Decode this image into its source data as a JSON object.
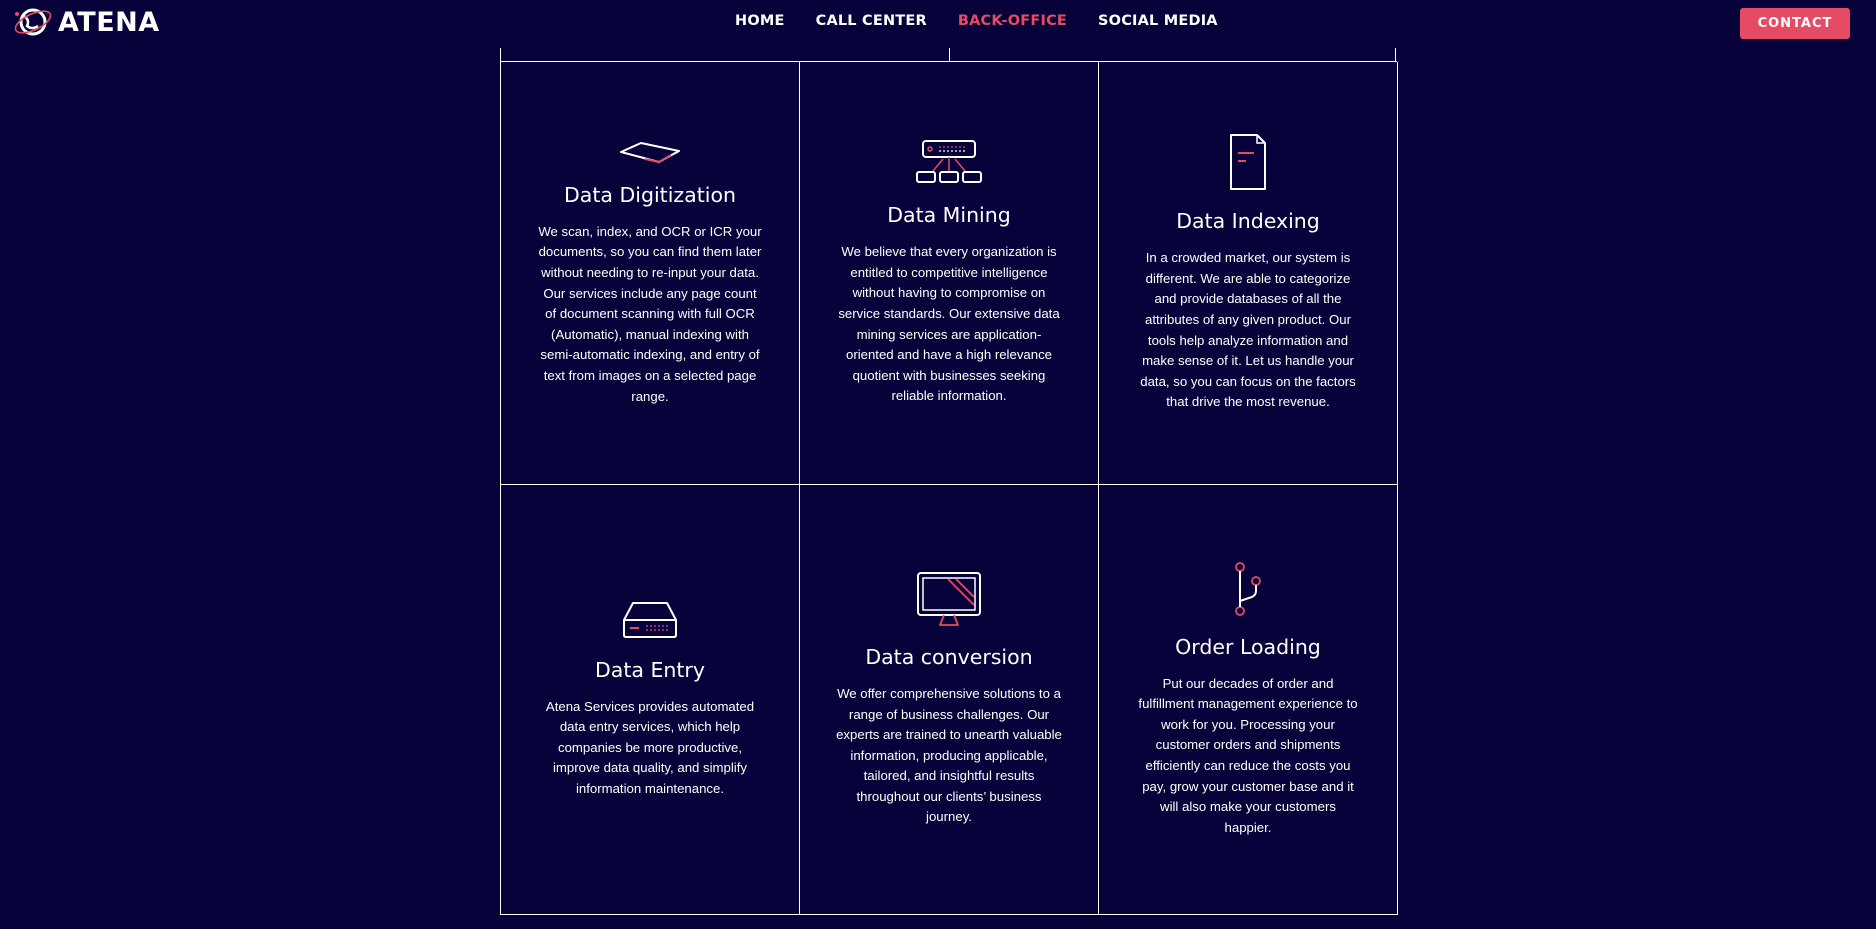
{
  "header": {
    "logo_text": "ATENA",
    "nav": [
      {
        "label": "HOME",
        "active": false
      },
      {
        "label": "CALL CENTER",
        "active": false
      },
      {
        "label": "BACK-OFFICE",
        "active": true
      },
      {
        "label": "SOCIAL MEDIA",
        "active": false
      }
    ],
    "contact_label": "CONTACT"
  },
  "colors": {
    "background": "#07033a",
    "accent": "#e54b64",
    "text": "#ffffff"
  },
  "services": [
    {
      "icon": "scanner-icon",
      "title": "Data Digitization",
      "description": "We scan, index, and OCR or ICR your documents, so you can find them later without needing to re-input your data. Our services include any page count of document scanning with full OCR (Automatic), manual indexing with semi-automatic indexing, and entry of text from images on a selected page range."
    },
    {
      "icon": "network-icon",
      "title": "Data Mining",
      "description": "We believe that every organization is entitled to competitive intelligence without having to compromise on service standards. Our extensive data mining services are application-oriented and have a high relevance quotient with businesses seeking reliable information."
    },
    {
      "icon": "document-icon",
      "title": "Data Indexing",
      "description": "In a crowded market, our system is different. We are able to categorize and provide databases of all the attributes of any given product. Our tools help analyze information and make sense of it. Let us handle your data, so you can focus on the factors that drive the most revenue."
    },
    {
      "icon": "hard-drive-icon",
      "title": "Data Entry",
      "description": "Atena Services provides automated data entry services, which help companies be more productive, improve data quality, and simplify information maintenance."
    },
    {
      "icon": "monitor-icon",
      "title": "Data conversion",
      "description": "We offer comprehensive solutions to a range of business challenges. Our experts are trained to unearth valuable information, producing applicable, tailored, and insightful results throughout our clients’ business journey."
    },
    {
      "icon": "branch-icon",
      "title": "Order Loading",
      "description": "Put our decades of order and fulfillment management experience to work for you. Processing your customer orders and shipments efficiently can reduce the costs you pay, grow your customer base and it will also make your customers happier."
    }
  ]
}
